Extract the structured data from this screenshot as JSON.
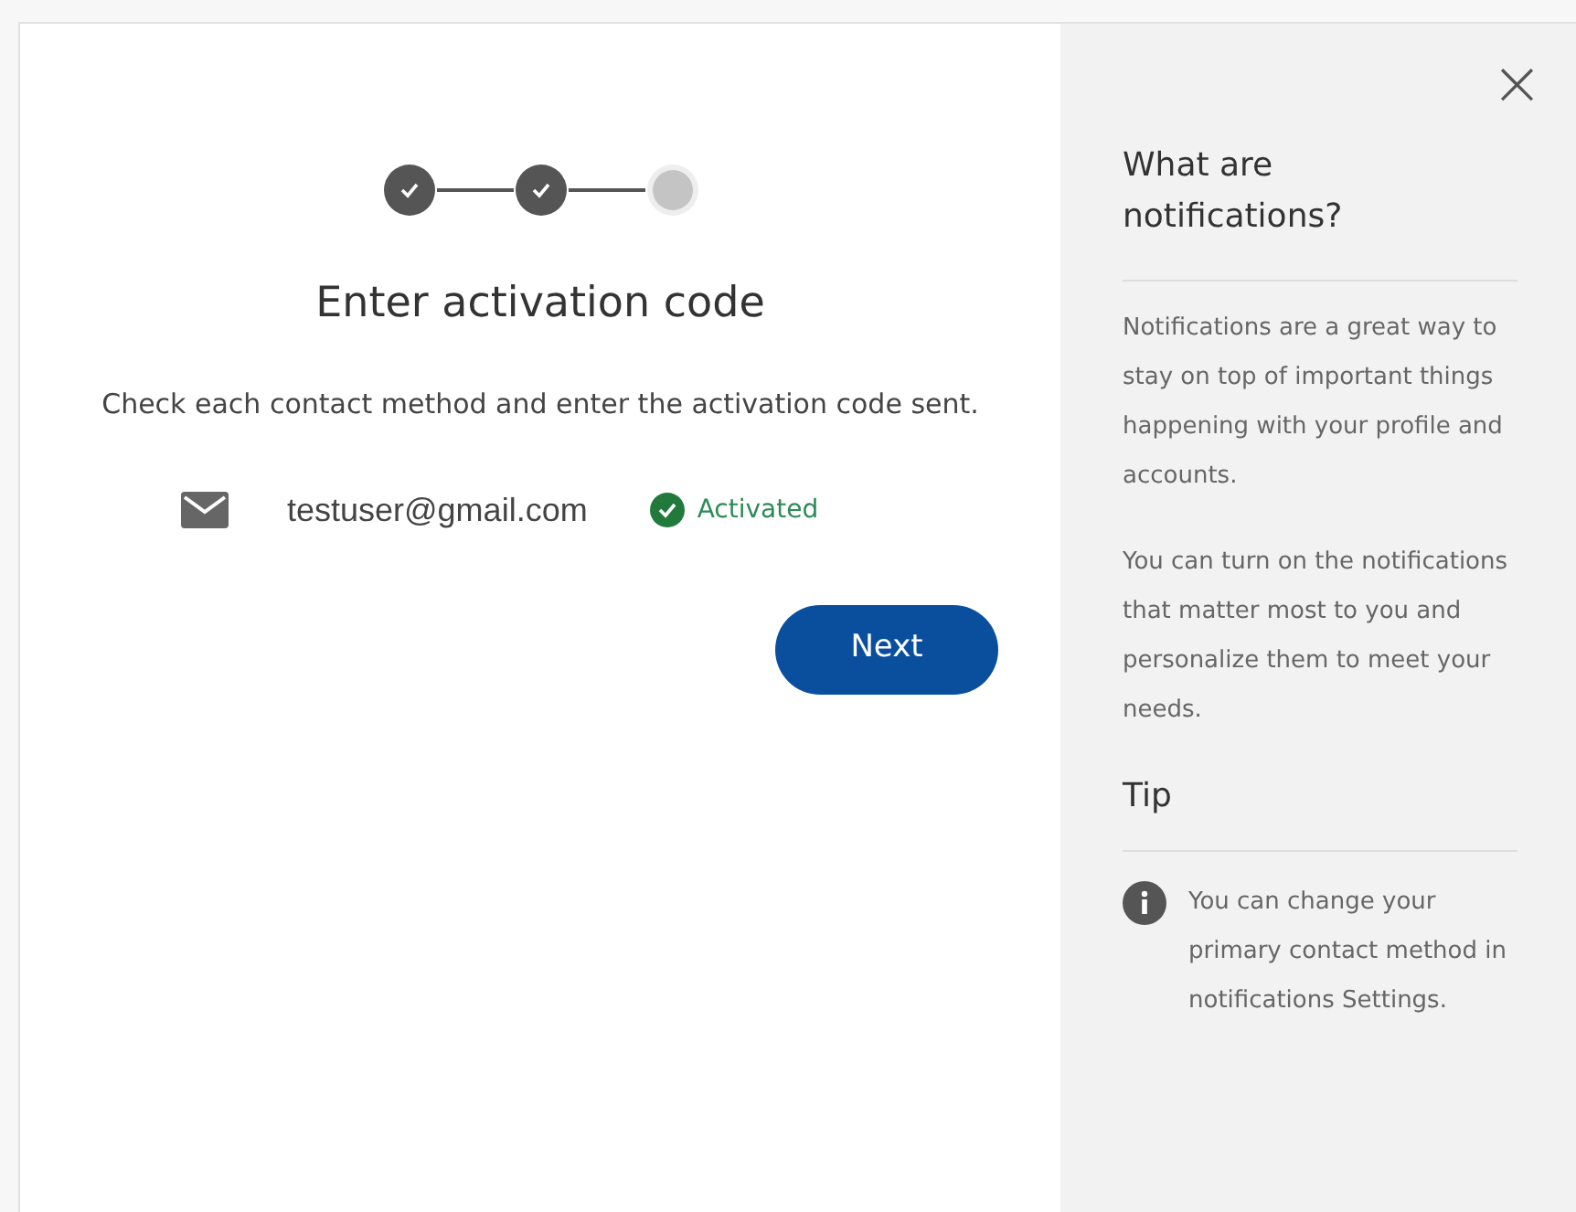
{
  "stepper": {
    "steps": [
      {
        "done": true
      },
      {
        "done": true
      },
      {
        "done": false
      }
    ]
  },
  "main": {
    "title": "Enter activation code",
    "description": "Check each contact method and enter the activation code sent.",
    "contacts": [
      {
        "kind": "email",
        "value": "testuser@gmail.com",
        "status": "Activated",
        "activated": true
      }
    ],
    "next_button": "Next"
  },
  "help_panel": {
    "close": "×",
    "title": "What are notifications?",
    "paragraphs": [
      "Notifications are a great way to stay on top of important things happening with your profile and accounts.",
      "You can turn on the notifications that matter most to you and personalize them to meet your needs."
    ],
    "tip_title": "Tip",
    "tip_text": "You can change your primary contact method in notifications Settings."
  }
}
